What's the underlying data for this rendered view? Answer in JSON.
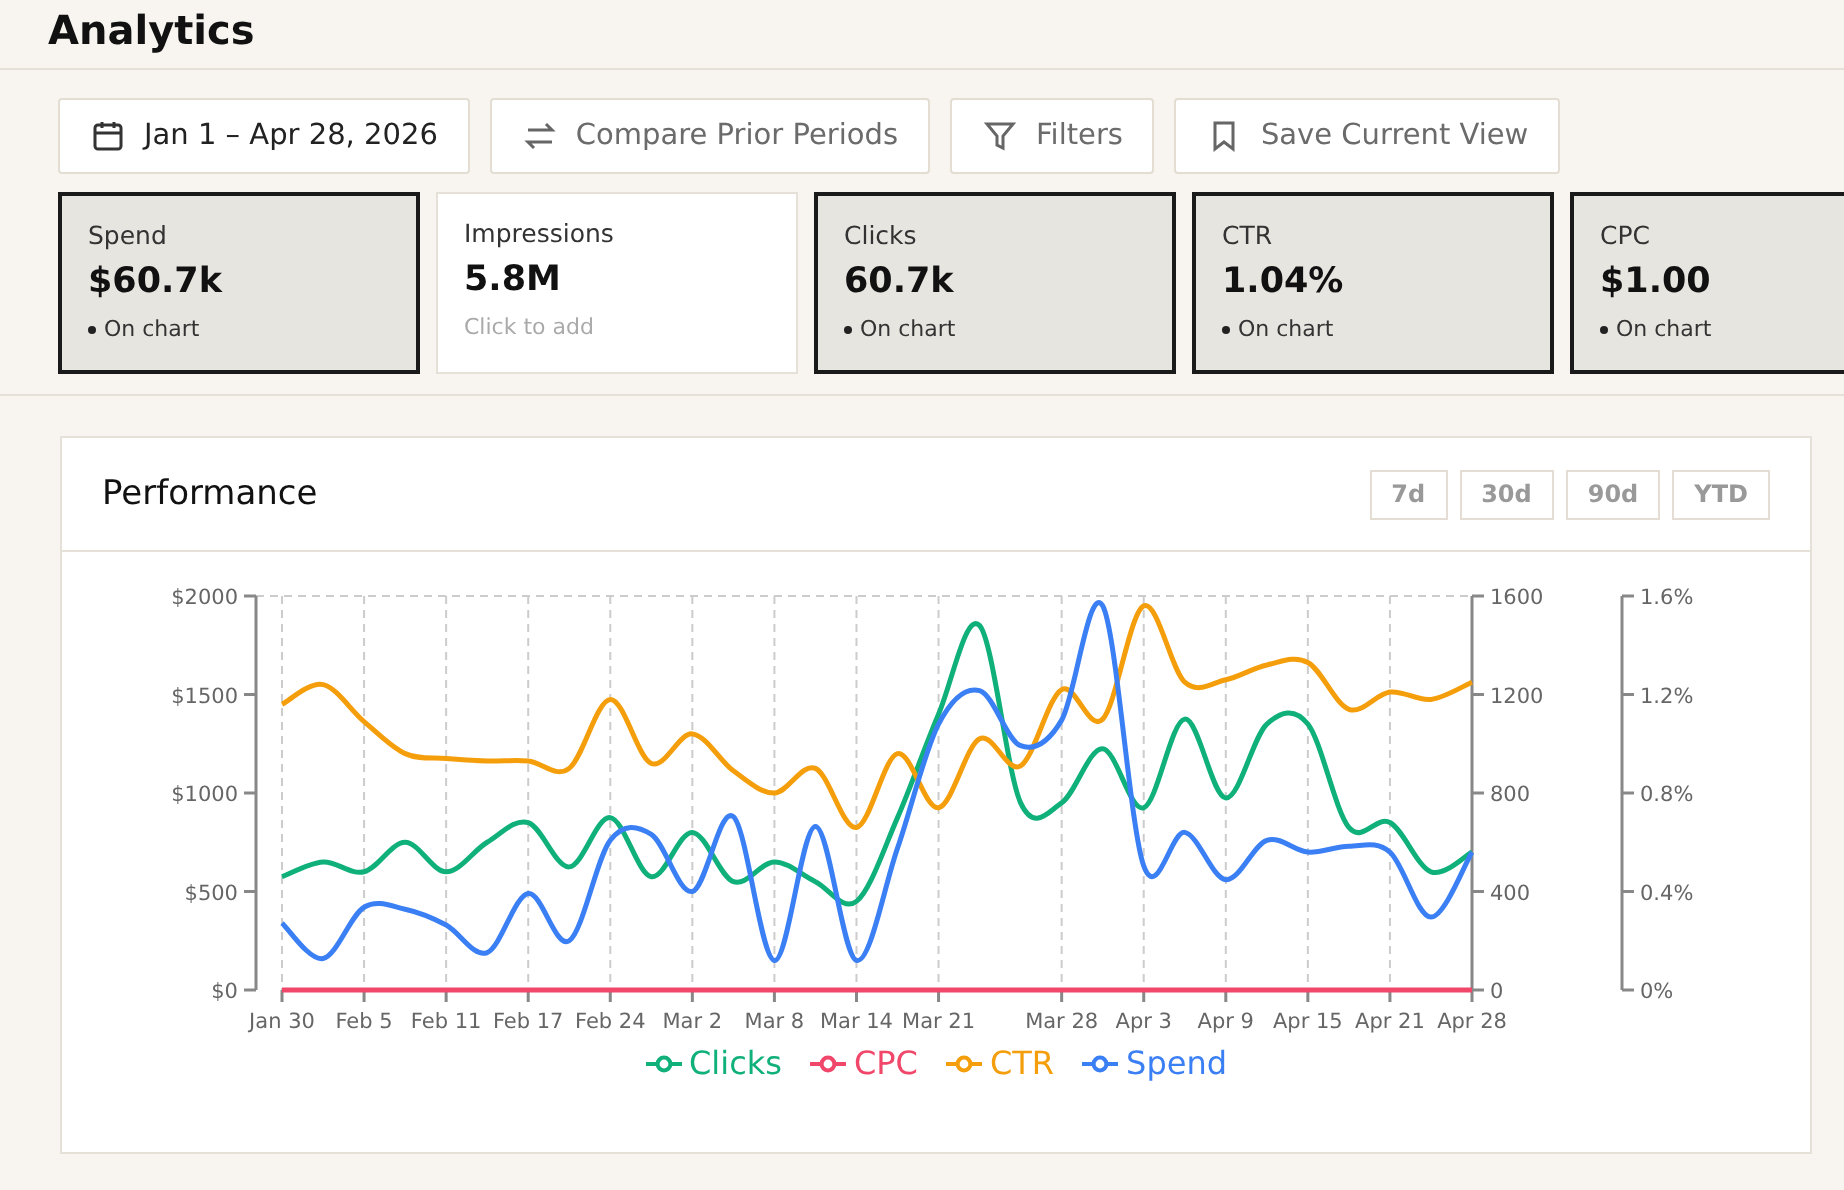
{
  "page": {
    "title": "Analytics"
  },
  "toolbar": [
    {
      "kind": "calendar",
      "label": "Jan 1 – Apr 28, 2026"
    },
    {
      "kind": "compare",
      "label": "Compare Prior Periods"
    },
    {
      "kind": "filter",
      "label": "Filters"
    },
    {
      "kind": "bookmark",
      "label": "Save Current View"
    }
  ],
  "metrics": [
    {
      "label": "Spend",
      "value": "$60.7k",
      "note": "On chart",
      "selected": true
    },
    {
      "label": "Impressions",
      "value": "5.8M",
      "note": "Click to add",
      "selected": false
    },
    {
      "label": "Clicks",
      "value": "60.7k",
      "note": "On chart",
      "selected": true
    },
    {
      "label": "CTR",
      "value": "1.04%",
      "note": "On chart",
      "selected": true
    },
    {
      "label": "CPC",
      "value": "$1.00",
      "note": "On chart",
      "selected": true
    }
  ],
  "performance": {
    "title": "Performance",
    "ranges": [
      {
        "label": "7d",
        "selected": false
      },
      {
        "label": "30d",
        "selected": false
      },
      {
        "label": "90d",
        "selected": false
      },
      {
        "label": "YTD",
        "selected": false
      }
    ],
    "chart_data": {
      "type": "line",
      "grid": true,
      "legend": "bottom",
      "categories": [
        "Jan 30",
        null,
        "Feb 5",
        null,
        "Feb 11",
        null,
        "Feb 17",
        null,
        "Feb 24",
        null,
        "Mar 2",
        null,
        "Mar 8",
        null,
        "Mar 14",
        null,
        "Mar 21",
        null,
        null,
        "Mar 28",
        null,
        "Apr 3",
        null,
        "Apr 9",
        null,
        "Apr 15",
        null,
        "Apr 21",
        null,
        "Apr 28"
      ],
      "ylim": [
        0,
        2000
      ],
      "yticks": [
        {
          "value": 0,
          "label": "$0"
        },
        {
          "value": 500,
          "label": "$500"
        },
        {
          "value": 1000,
          "label": "$1000"
        },
        {
          "value": 1500,
          "label": "$1500"
        },
        {
          "value": 2000,
          "label": "$2000"
        }
      ],
      "y2lim": [
        0,
        1600
      ],
      "y2ticks": [
        {
          "value": 0,
          "label": "0"
        },
        {
          "value": 400,
          "label": "400"
        },
        {
          "value": 800,
          "label": "800"
        },
        {
          "value": 1200,
          "label": "1200"
        },
        {
          "value": 1600,
          "label": "1600"
        }
      ],
      "y3lim": [
        0,
        1.6
      ],
      "y3ticks": [
        {
          "value": 0,
          "label": "0%"
        },
        {
          "value": 0.4,
          "label": "0.4%"
        },
        {
          "value": 0.8,
          "label": "0.8%"
        },
        {
          "value": 1.2,
          "label": "1.2%"
        },
        {
          "value": 1.6,
          "label": "1.6%"
        }
      ],
      "series": [
        {
          "name": "Clicks",
          "color": "#10b07a",
          "axis": "y2",
          "values": [
            460,
            520,
            480,
            600,
            480,
            600,
            680,
            500,
            700,
            460,
            640,
            440,
            520,
            440,
            360,
            700,
            1120,
            1480,
            760,
            760,
            980,
            740,
            1100,
            780,
            1080,
            1080,
            660,
            680,
            480,
            560
          ]
        },
        {
          "name": "CPC",
          "color": "#f0476a",
          "axis": "y",
          "values": [
            0,
            0,
            0,
            0,
            0,
            0,
            0,
            0,
            0,
            0,
            0,
            0,
            0,
            0,
            0,
            0,
            0,
            0,
            0,
            0,
            0,
            0,
            0,
            0,
            0,
            0,
            0,
            0,
            0,
            0
          ]
        },
        {
          "name": "CTR",
          "color": "#f59e0b",
          "axis": "y3",
          "values": [
            1.16,
            1.24,
            1.09,
            0.96,
            0.94,
            0.93,
            0.93,
            0.9,
            1.18,
            0.92,
            1.04,
            0.89,
            0.8,
            0.9,
            0.66,
            0.96,
            0.74,
            1.02,
            0.91,
            1.22,
            1.1,
            1.56,
            1.25,
            1.26,
            1.32,
            1.33,
            1.14,
            1.21,
            1.18,
            1.25
          ]
        },
        {
          "name": "Spend",
          "color": "#3b7ff5",
          "axis": "y",
          "values": [
            340,
            160,
            420,
            410,
            330,
            190,
            490,
            250,
            760,
            790,
            500,
            880,
            150,
            830,
            150,
            720,
            1350,
            1520,
            1240,
            1370,
            1950,
            630,
            800,
            560,
            760,
            700,
            730,
            700,
            370,
            700
          ]
        }
      ]
    }
  }
}
